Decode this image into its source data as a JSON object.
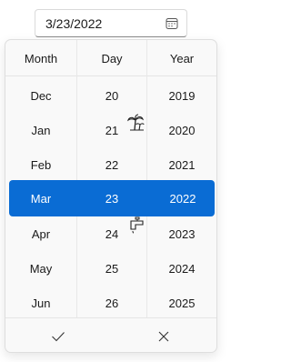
{
  "date_input": {
    "value": "3/23/2022",
    "icon": "calendar-icon"
  },
  "picker": {
    "headers": {
      "month": "Month",
      "day": "Day",
      "year": "Year"
    },
    "months": [
      "Dec",
      "Jan",
      "Feb",
      "Mar",
      "Apr",
      "May",
      "Jun"
    ],
    "days": [
      "20",
      "21",
      "22",
      "23",
      "24",
      "25",
      "26"
    ],
    "years": [
      "2019",
      "2020",
      "2021",
      "2022",
      "2023",
      "2024",
      "2025"
    ],
    "selected": {
      "month": "Mar",
      "day": "23",
      "year": "2022"
    },
    "accent_color": "#0a6cd4",
    "decorations": [
      "palm-tree-icon",
      "faucet-icon"
    ]
  },
  "footer": {
    "accept_icon": "checkmark-icon",
    "dismiss_icon": "close-icon"
  }
}
